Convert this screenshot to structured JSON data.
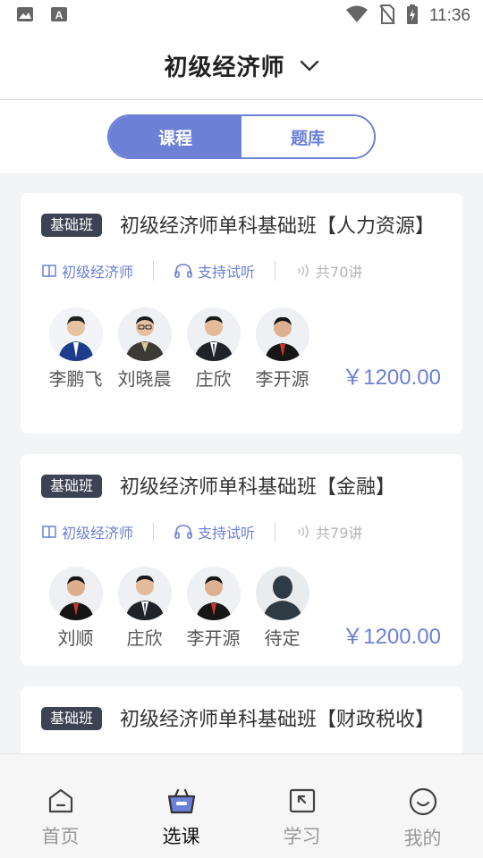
{
  "status_bar": {
    "time": "11:36"
  },
  "header": {
    "title": "初级经济师"
  },
  "segment": {
    "tabs": [
      "课程",
      "题库"
    ]
  },
  "courses": [
    {
      "badge": "基础班",
      "title": "初级经济师单科基础班【人力资源】",
      "category": "初级经济师",
      "trial": "支持试听",
      "lessons": "共70讲",
      "teachers": [
        "李鹏飞",
        "刘晓晨",
        "庄欣",
        "李开源"
      ],
      "price": "￥1200.00"
    },
    {
      "badge": "基础班",
      "title": "初级经济师单科基础班【金融】",
      "category": "初级经济师",
      "trial": "支持试听",
      "lessons": "共79讲",
      "teachers": [
        "刘顺",
        "庄欣",
        "李开源",
        "待定"
      ],
      "price": "￥1200.00"
    },
    {
      "badge": "基础班",
      "title": "初级经济师单科基础班【财政税收】"
    }
  ],
  "nav": {
    "home": "首页",
    "courses": "选课",
    "study": "学习",
    "mine": "我的"
  },
  "colors": {
    "accent": "#6c80d6",
    "badge": "#3d4354"
  }
}
